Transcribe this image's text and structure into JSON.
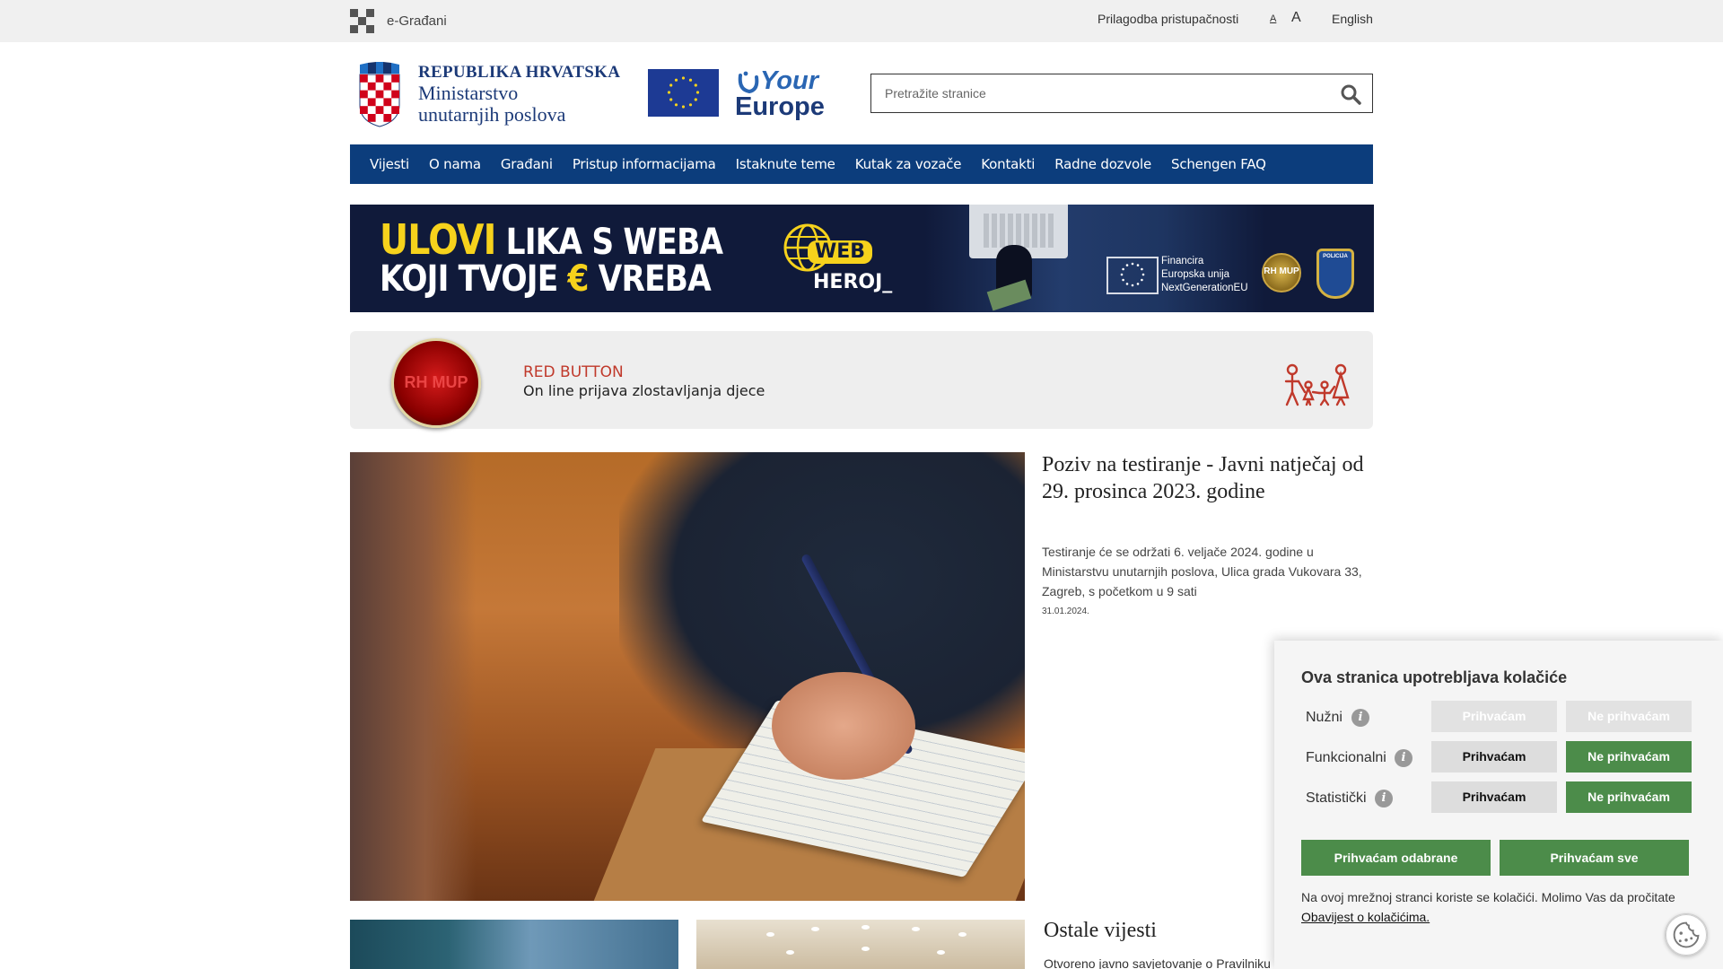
{
  "topbar": {
    "egradani_label": "e-Građani",
    "accessibility_label": "Prilagodba pristupačnosti",
    "font_small": "A",
    "font_large": "A",
    "language": "English"
  },
  "header": {
    "line1": "REPUBLIKA HRVATSKA",
    "line2": "Ministarstvo",
    "line3": "unutarnjih poslova",
    "your_europe_your": "Your",
    "your_europe_europe": "Europe",
    "search_placeholder": "Pretražite stranice",
    "search_icon": "search-icon"
  },
  "nav": {
    "items": [
      "Vijesti",
      "O nama",
      "Građani",
      "Pristup informacijama",
      "Istaknute teme",
      "Kutak za vozače",
      "Kontakti",
      "Radne dozvole",
      "Schengen FAQ"
    ]
  },
  "banner_web": {
    "ulovi": "ULOVI",
    "line1_rest": " LIKA S WEBA",
    "line2_a": "KOJI TVOJE ",
    "euro": "€",
    "line2_b": " VREBA",
    "web": "WEB",
    "heroj": "HEROJ_",
    "eu_funding_1": "Financira",
    "eu_funding_2": "Europska unija",
    "eu_funding_3": "NextGenerationEU",
    "mup_badge": "RH MUP",
    "police_badge": "POLICIJA"
  },
  "banner_red": {
    "button_text": "RH MUP",
    "title": "RED BUTTON",
    "subtitle": "On line prijava  zlostavljanja djece"
  },
  "featured": {
    "title": "Poziv na testiranje - Javni natječaj od 29. prosinca 2023. godine",
    "description": "Testiranje će se održati 6. veljače 2024. godine u Ministarstvu unutarnjih poslova, Ulica grada Vukovara 33, Zagreb, s početkom u 9 sati",
    "date": "31.01.2024."
  },
  "other_news": {
    "heading": "Ostale vijesti",
    "first_item": "Otvoreno javno savjetovanje o Pravilniku"
  },
  "cookies": {
    "title": "Ova stranica upotrebljava kolačiće",
    "rows": [
      {
        "label": "Nužni",
        "accept": "Prihvaćam",
        "reject": "Ne prihvaćam"
      },
      {
        "label": "Funkcionalni",
        "accept": "Prihvaćam",
        "reject": "Ne prihvaćam"
      },
      {
        "label": "Statistički",
        "accept": "Prihvaćam",
        "reject": "Ne prihvaćam"
      }
    ],
    "accept_selected": "Prihvaćam odabrane",
    "accept_all": "Prihvaćam sve",
    "note": "Na ovoj mrežnoj stranci koriste se kolačići. Molimo Vas da pročitate",
    "link": "Obavijest o kolačićima.",
    "info_glyph": "i"
  },
  "colors": {
    "nav_bg": "#0c3d7c",
    "accept_green": "#4c8c4a",
    "red_title": "#c0392b"
  }
}
